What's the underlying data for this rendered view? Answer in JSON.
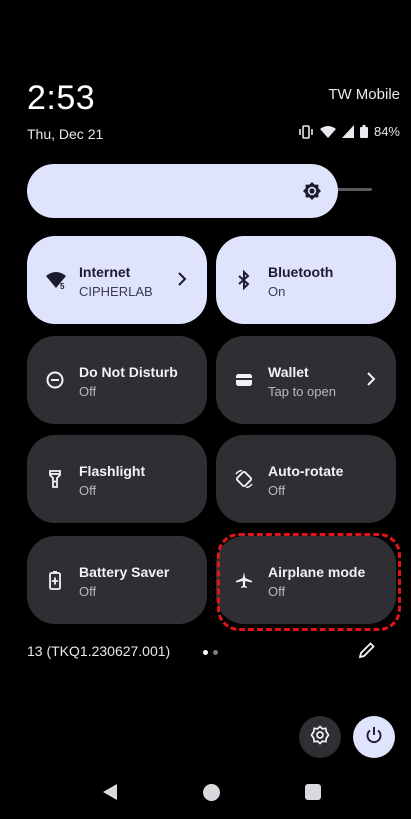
{
  "header": {
    "time": "2:53",
    "carrier": "TW Mobile",
    "date": "Thu, Dec 21",
    "battery": "84%"
  },
  "brightness": {
    "level": 0.78
  },
  "tiles": [
    {
      "title": "Internet",
      "subtitle": "CIPHERLAB",
      "state": "on",
      "icon": "wifi-icon",
      "chevron": true
    },
    {
      "title": "Bluetooth",
      "subtitle": "On",
      "state": "on",
      "icon": "bluetooth-icon",
      "chevron": false
    },
    {
      "title": "Do Not Disturb",
      "subtitle": "Off",
      "state": "off",
      "icon": "do-not-disturb-icon",
      "chevron": false
    },
    {
      "title": "Wallet",
      "subtitle": "Tap to open",
      "state": "off",
      "icon": "wallet-icon",
      "chevron": true
    },
    {
      "title": "Flashlight",
      "subtitle": "Off",
      "state": "off",
      "icon": "flashlight-icon",
      "chevron": false
    },
    {
      "title": "Auto-rotate",
      "subtitle": "Off",
      "state": "off",
      "icon": "auto-rotate-icon",
      "chevron": false
    },
    {
      "title": "Battery Saver",
      "subtitle": "Off",
      "state": "off",
      "icon": "battery-saver-icon",
      "chevron": false
    },
    {
      "title": "Airplane mode",
      "subtitle": "Off",
      "state": "off",
      "icon": "airplane-icon",
      "chevron": false
    }
  ],
  "footer": {
    "build": "13 (TKQ1.230627.001)"
  },
  "colors": {
    "tile_on": "#dfe3fb",
    "tile_off": "#2f2f33",
    "highlight": "#e0151c"
  }
}
